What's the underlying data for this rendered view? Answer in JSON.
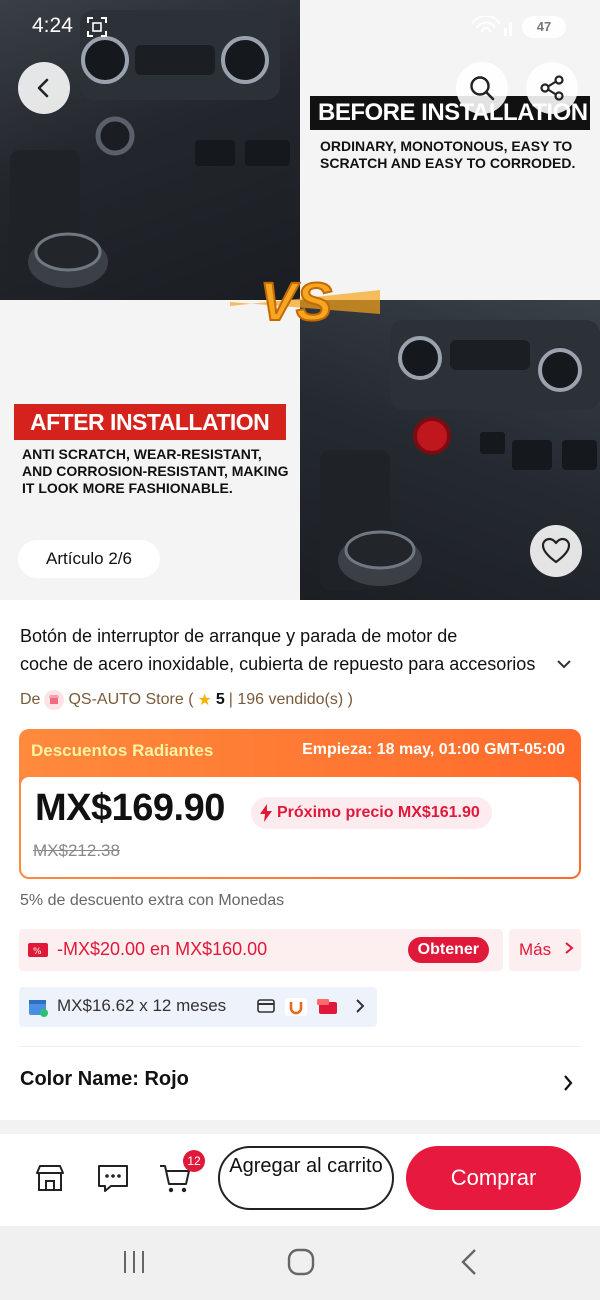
{
  "status_bar": {
    "time": "4:24",
    "battery": "47"
  },
  "gallery": {
    "counter": "Artículo 2/6",
    "before_title": "BEFORE INSTALLATION",
    "before_desc": "ORDINARY, MONOTONOUS, EASY TO SCRATCH AND EASY TO CORRODED.",
    "after_title": "AFTER INSTALLATION",
    "after_desc": "ANTI SCRATCH, WEAR-RESISTANT, AND CORROSION-RESISTANT, MAKING IT LOOK MORE FASHIONABLE.",
    "vs_text": "VS"
  },
  "product": {
    "title_line1": "Botón de interruptor de arranque y parada de motor de",
    "title_line2": "coche de acero inoxidable, cubierta de repuesto para accesorios",
    "store_prefix": "De",
    "store_name": "QS-AUTO Store (",
    "rating": "5",
    "sold": "| 196 vendido(s) )"
  },
  "promo": {
    "label": "Descuentos Radiantes",
    "starts": "Empieza:  18 may, 01:00 GMT-05:00",
    "price": "MX$169.90",
    "next_price": "Próximo precio MX$161.90",
    "original_price": "MX$212.38"
  },
  "coins_text": "5% de descuento extra con Monedas",
  "coupon": {
    "text": "-MX$20.00 en MX$160.00",
    "get_label": "Obtener",
    "more_label": "Más"
  },
  "installments": {
    "text": "MX$16.62 x 12 meses"
  },
  "color": {
    "label": "Color Name: Rojo"
  },
  "action_bar": {
    "cart_count": "12",
    "add_to_cart": "Agregar al carrito",
    "buy": "Comprar"
  },
  "colors": {
    "accent": "#e8193e",
    "promo_orange": "#ff7a33",
    "store_brown": "#7a5a3a"
  }
}
